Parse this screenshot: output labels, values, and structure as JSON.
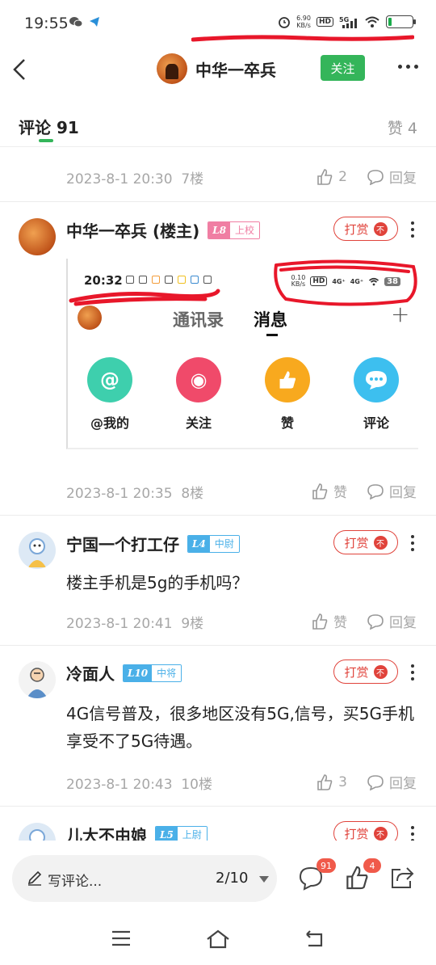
{
  "status_bar": {
    "time": "19:55",
    "net_speed_value": "6.90",
    "net_speed_unit": "KB/s",
    "hd": "HD",
    "network": "5G",
    "battery_level": 0.15,
    "battery_color": "#1aab4a"
  },
  "header": {
    "title": "中华一卒兵",
    "follow_label": "关注"
  },
  "tabs": {
    "comments_label": "评论 91",
    "likes_label": "赞 4"
  },
  "floor7": {
    "meta": "2023-8-1 20:30  7楼",
    "likes": "2",
    "reply": "回复"
  },
  "comments": [
    {
      "name": "中华一卒兵 (楼主)",
      "level_num": "L8",
      "level_title": "上校",
      "level_color": "#f07ea3",
      "reward": "打赏",
      "meta": "2023-8-1 20:35  8楼",
      "like_label": "赞",
      "reply": "回复",
      "embed": {
        "time": "20:32",
        "speed": "0.10",
        "speed_unit": "KB/s",
        "hd": "HD",
        "net1": "4G⁺",
        "net2": "4G⁺",
        "battery": "38",
        "tab_contacts": "通讯录",
        "tab_messages": "消息",
        "plus": "+",
        "items": [
          {
            "label": "@我的",
            "glyph": "@",
            "color": "#3ecfad"
          },
          {
            "label": "关注",
            "glyph": "◉",
            "color": "#f04a6a"
          },
          {
            "label": "赞",
            "glyph": "👍",
            "color": "#f8a91e"
          },
          {
            "label": "评论",
            "glyph": "•••",
            "color": "#3dbfef"
          }
        ]
      }
    },
    {
      "name": "宁国一个打工仔",
      "level_num": "L4",
      "level_title": "中尉",
      "level_color": "#4ab0e8",
      "reward": "打赏",
      "text": "楼主手机是5g的手机吗？",
      "meta": "2023-8-1 20:41  9楼",
      "like_label": "赞",
      "reply": "回复"
    },
    {
      "name": "冷面人",
      "level_num": "L10",
      "level_title": "中将",
      "level_color": "#4ab0e8",
      "reward": "打赏",
      "text": "4G信号普及，很多地区没有5G,信号，买5G手机享受不了5G待遇。",
      "meta": "2023-8-1 20:43  10楼",
      "likes": "3",
      "reply": "回复"
    },
    {
      "name": "儿大不由娘",
      "level_num": "L5",
      "level_title": "上尉",
      "level_color": "#4ab0e8",
      "reward": "打赏"
    }
  ],
  "bottom_bar": {
    "input_placeholder": "写评论...",
    "page_indicator": "2/10",
    "comment_badge": "91",
    "like_badge": "4"
  },
  "colors": {
    "accent_green": "#34b55a",
    "reward_red": "#e0433b",
    "meta_gray": "#a7a7a7",
    "annotation_red": "#e8172a"
  }
}
